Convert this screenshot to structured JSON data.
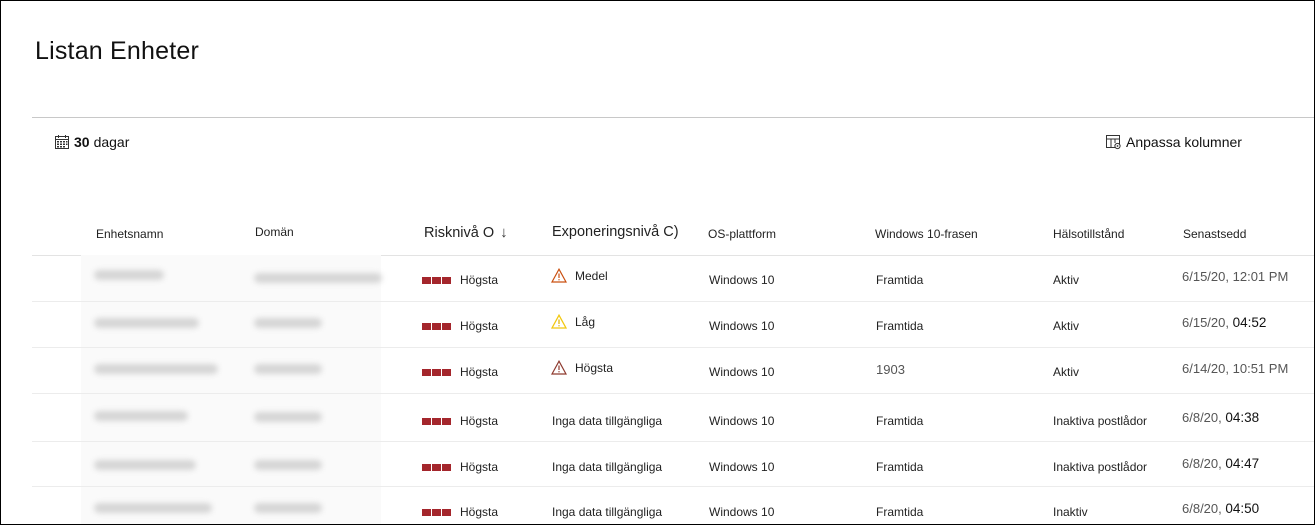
{
  "page": {
    "title": "Listan Enheter"
  },
  "toolbar": {
    "range_number": "30",
    "range_unit": "dagar",
    "customize_label": "Anpassa kolumner"
  },
  "columns": {
    "name": "Enhetsnamn",
    "domain": "Domän",
    "risk": "Risknivå O",
    "risk_sort": "↓",
    "exposure": "Exponeringsnivå C)",
    "os": "OS-plattform",
    "win10": "Windows 10-frasen",
    "health": "Hälsotillstånd",
    "last_seen": "Senastsedd"
  },
  "colors": {
    "risk_high": "#a4262c",
    "warning_medium": "#ca5010",
    "warning_low": "#f2c811",
    "warning_high": "#8e3a2f"
  },
  "rows": [
    {
      "risk": "Högsta",
      "exposure_icon": "warning-icon",
      "exposure_color": "#ca5010",
      "exposure": "Medel",
      "os": "Windows 10",
      "win10": "Framtida",
      "health": "Aktiv",
      "date": "6/15/20,",
      "time": "12:01 PM"
    },
    {
      "risk": "Högsta",
      "exposure_icon": "warning-icon",
      "exposure_color": "#f2c811",
      "exposure": "Låg",
      "os": "Windows 10",
      "win10": "Framtida",
      "health": "Aktiv",
      "date": "6/15/20,",
      "time": "04:52"
    },
    {
      "risk": "Högsta",
      "exposure_icon": "warning-icon",
      "exposure_color": "#8e3a2f",
      "exposure": "Högsta",
      "os": "Windows 10",
      "win10": "1903",
      "health": "Aktiv",
      "date": "6/14/20,",
      "time": "10:51 PM"
    },
    {
      "risk": "Högsta",
      "exposure_icon": "",
      "exposure_color": "",
      "exposure": "Inga data tillgängliga",
      "os": "Windows 10",
      "win10": "Framtida",
      "health": "Inaktiva postlådor",
      "date": "6/8/20,",
      "time": "04:38"
    },
    {
      "risk": "Högsta",
      "exposure_icon": "",
      "exposure_color": "",
      "exposure": "Inga data tillgängliga",
      "os": "Windows 10",
      "win10": "Framtida",
      "health": "Inaktiva postlådor",
      "date": "6/8/20,",
      "time": "04:47"
    },
    {
      "risk": "Högsta",
      "exposure_icon": "",
      "exposure_color": "",
      "exposure": "Inga data tillgängliga",
      "os": "Windows 10",
      "win10": "Framtida",
      "health": "Inaktiv",
      "date": "6/8/20,",
      "time": "04:50"
    }
  ]
}
